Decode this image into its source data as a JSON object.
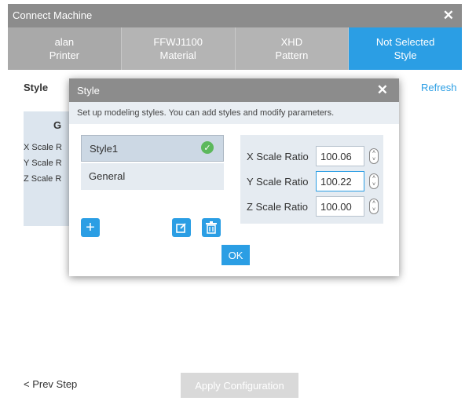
{
  "window": {
    "title": "Connect Machine",
    "close_icon": "close-icon"
  },
  "steps": [
    {
      "line1": "alan",
      "line2": "Printer"
    },
    {
      "line1": "FFWJ1100",
      "line2": "Material"
    },
    {
      "line1": "XHD",
      "line2": "Pattern"
    },
    {
      "line1": "Not Selected",
      "line2": "Style"
    }
  ],
  "page": {
    "style_label": "Style",
    "refresh": "Refresh",
    "card": {
      "heading": "G",
      "x": "X Scale R",
      "y": "Y Scale R",
      "z": "Z Scale R"
    },
    "prev_step": "< Prev Step",
    "apply": "Apply Configuration"
  },
  "modal": {
    "title": "Style",
    "description": "Set up modeling styles. You can add styles and modify parameters.",
    "styles": [
      {
        "name": "Style1",
        "selected": true
      },
      {
        "name": "General",
        "selected": false
      }
    ],
    "params": [
      {
        "label": "X Scale Ratio",
        "value": "100.06"
      },
      {
        "label": "Y Scale Ratio",
        "value": "100.22"
      },
      {
        "label": "Z Scale Ratio",
        "value": "100.00"
      }
    ],
    "ok": "OK",
    "icons": {
      "add": "plus-icon",
      "edit": "edit-icon",
      "delete": "trash-icon",
      "check": "check-icon"
    }
  },
  "colors": {
    "accent": "#2b9ee4",
    "titlebar": "#8c8c8c",
    "success": "#5cb85c"
  }
}
